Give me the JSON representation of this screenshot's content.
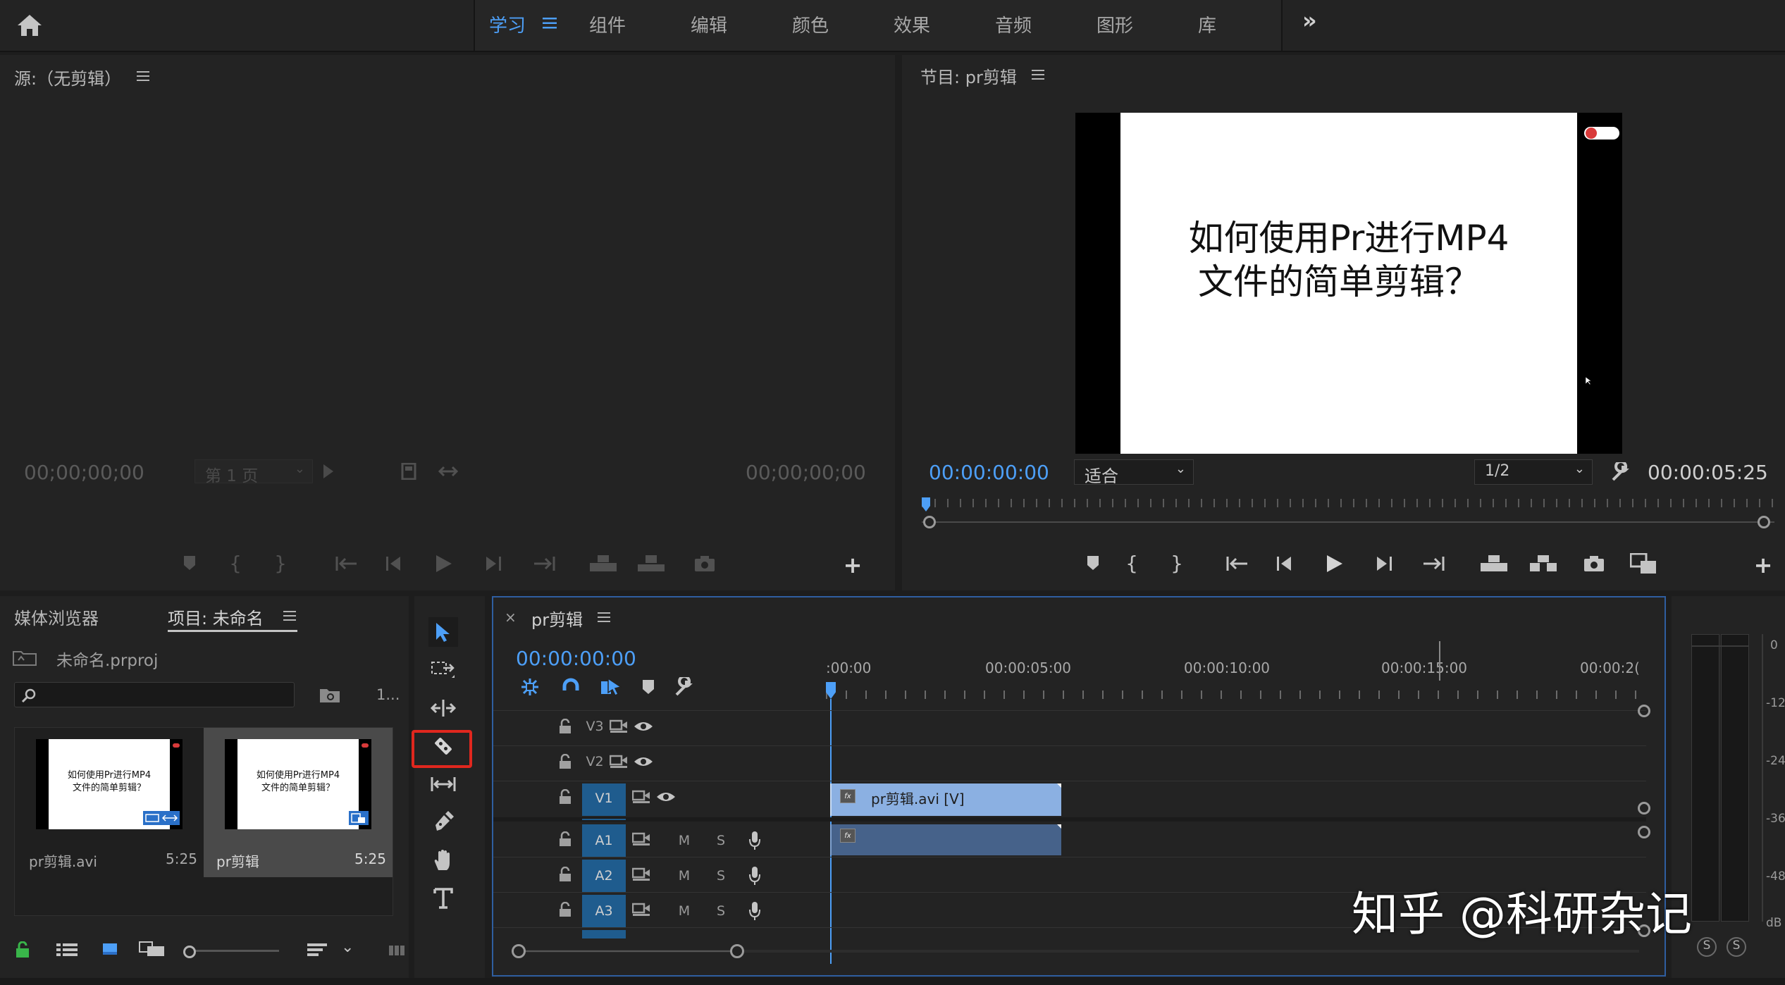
{
  "topbar": {
    "tabs": [
      {
        "label": "学习",
        "active": true
      },
      {
        "label": "组件"
      },
      {
        "label": "编辑"
      },
      {
        "label": "颜色"
      },
      {
        "label": "效果"
      },
      {
        "label": "音频"
      },
      {
        "label": "图形"
      },
      {
        "label": "库"
      }
    ],
    "overflow_label": "»",
    "accent": "#4d9ff7"
  },
  "source_monitor": {
    "title": "源:（无剪辑）",
    "timecode_left": "00;00;00;00",
    "timecode_right": "00;00;00;00",
    "page_select": "第 1 页"
  },
  "program_monitor": {
    "title": "节目: pr剪辑",
    "frame_text_line1": "如何使用Pr进行MP4",
    "frame_text_line2": "文件的简单剪辑？",
    "timecode_current": "00:00:00:00",
    "timecode_duration": "00:00:05:25",
    "fit_select": "适合",
    "resolution_select": "1/2"
  },
  "project_panel": {
    "tab_media_browser": "媒体浏览器",
    "tab_project": "项目: 未命名",
    "project_file": "未命名.prproj",
    "item_count": "1...",
    "items": [
      {
        "name": "pr剪辑.avi",
        "duration": "5:25",
        "thumb_line1": "如何使用Pr进行MP4",
        "thumb_line2": "文件的简单剪辑？"
      },
      {
        "name": "pr剪辑",
        "duration": "5:25",
        "thumb_line1": "如何使用Pr进行MP4",
        "thumb_line2": "文件的简单剪辑？"
      }
    ]
  },
  "timeline": {
    "sequence_name": "pr剪辑",
    "timecode": "00:00:00:00",
    "ruler_labels": [
      ":00:00",
      "00:00:05:00",
      "00:00:10:00",
      "00:00:15:00",
      "00:00:2("
    ],
    "video_tracks": [
      "V3",
      "V2",
      "V1"
    ],
    "audio_tracks": [
      "A1",
      "A2",
      "A3"
    ],
    "track_mute": "M",
    "track_solo": "S",
    "video_clip_label": "pr剪辑.avi [V]",
    "fx_label": "fx"
  },
  "audio_meter": {
    "scale": [
      "0",
      "-12",
      "-24",
      "-36",
      "-48",
      "dB"
    ],
    "solo_left": "S",
    "solo_right": "S"
  },
  "watermark": "知乎 @科研杂记"
}
